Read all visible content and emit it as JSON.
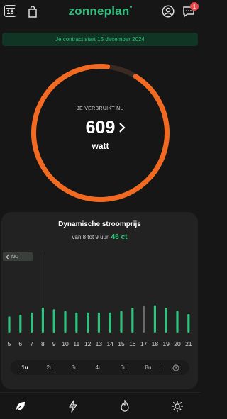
{
  "header": {
    "calendar_day": "18",
    "brand": "zonneplan",
    "notification_count": "1",
    "icons": [
      "calendar-icon",
      "shopping-bag-icon",
      "profile-icon",
      "chat-icon"
    ]
  },
  "contract_banner": "Je contract start 15 december 2024",
  "usage": {
    "label": "JE VERBRUIKT NU",
    "value": "609",
    "unit": "watt",
    "accent_color": "#f26a21"
  },
  "price_card": {
    "title": "Dynamische stroomprijs",
    "subtitle": "van 8 tot 9 uur",
    "price": "46 ct",
    "now_label": "NU",
    "accent_color": "#2ec27e"
  },
  "chart_data": {
    "type": "bar",
    "categories": [
      "5",
      "6",
      "7",
      "8",
      "9",
      "10",
      "11",
      "12",
      "13",
      "14",
      "15",
      "16",
      "17",
      "18",
      "19",
      "20",
      "21"
    ],
    "values": [
      20,
      22,
      25,
      31,
      29,
      27,
      25,
      25,
      25,
      25,
      27,
      31,
      33,
      34,
      31,
      27,
      23
    ],
    "current_index": 3,
    "highlight_index": 12
  },
  "range_tabs": [
    "1u",
    "2u",
    "3u",
    "4u",
    "6u",
    "8u"
  ],
  "active_tab": "1u",
  "bottom_nav": [
    "leaf-icon",
    "lightning-icon",
    "flame-icon",
    "sun-icon"
  ]
}
